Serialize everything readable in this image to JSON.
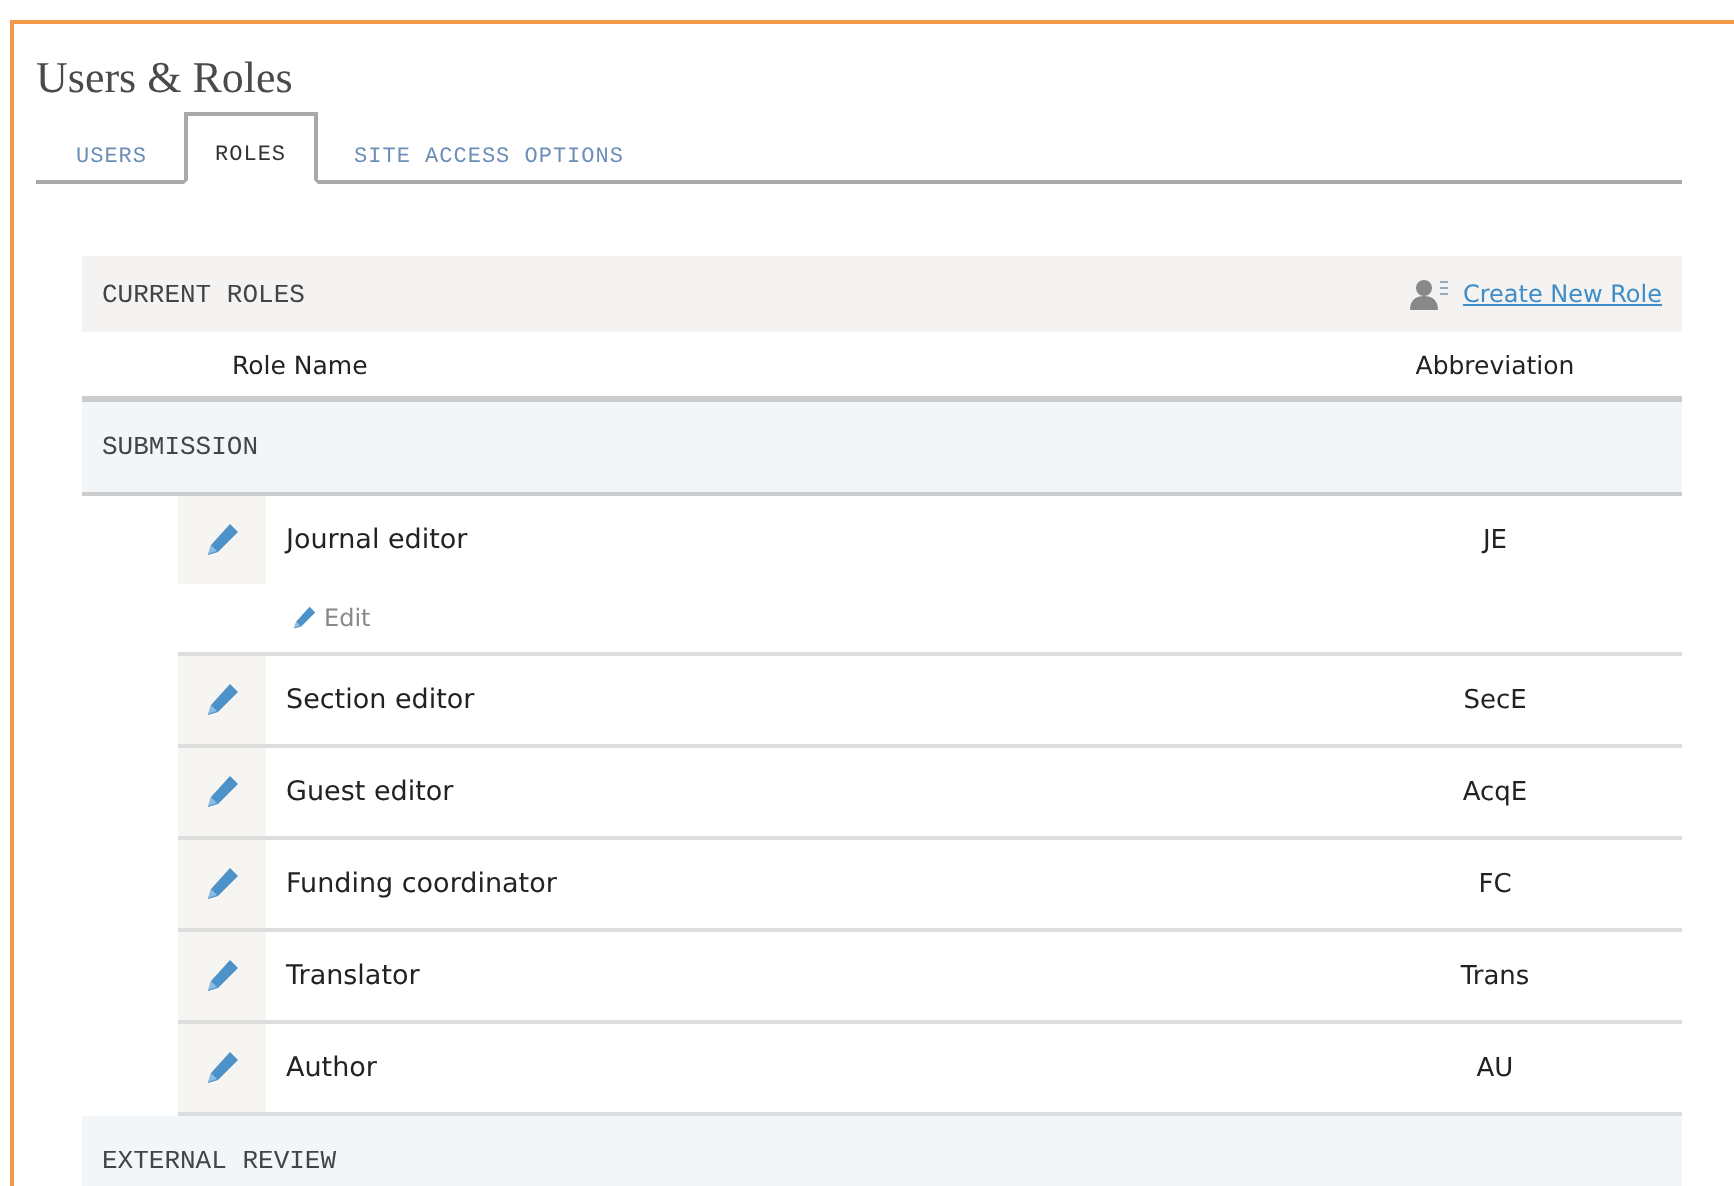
{
  "page": {
    "title": "Users & Roles"
  },
  "tabs": [
    {
      "label": "USERS",
      "selected": false
    },
    {
      "label": "ROLES",
      "selected": true
    },
    {
      "label": "SITE ACCESS OPTIONS",
      "selected": false
    }
  ],
  "roles_grid": {
    "title": "CURRENT ROLES",
    "create_link": "Create New Role",
    "columns": [
      "Role Name",
      "Abbreviation"
    ],
    "groups": [
      {
        "name": "SUBMISSION",
        "rows": [
          {
            "name": "Journal editor",
            "abbreviation": "JE",
            "expanded": true,
            "action": "Edit"
          },
          {
            "name": "Section editor",
            "abbreviation": "SecE",
            "expanded": false
          },
          {
            "name": "Guest editor",
            "abbreviation": "AcqE",
            "expanded": false
          },
          {
            "name": "Funding coordinator",
            "abbreviation": "FC",
            "expanded": false
          },
          {
            "name": "Translator",
            "abbreviation": "Trans",
            "expanded": false
          },
          {
            "name": "Author",
            "abbreviation": "AU",
            "expanded": false
          }
        ]
      },
      {
        "name": "EXTERNAL REVIEW"
      }
    ]
  }
}
